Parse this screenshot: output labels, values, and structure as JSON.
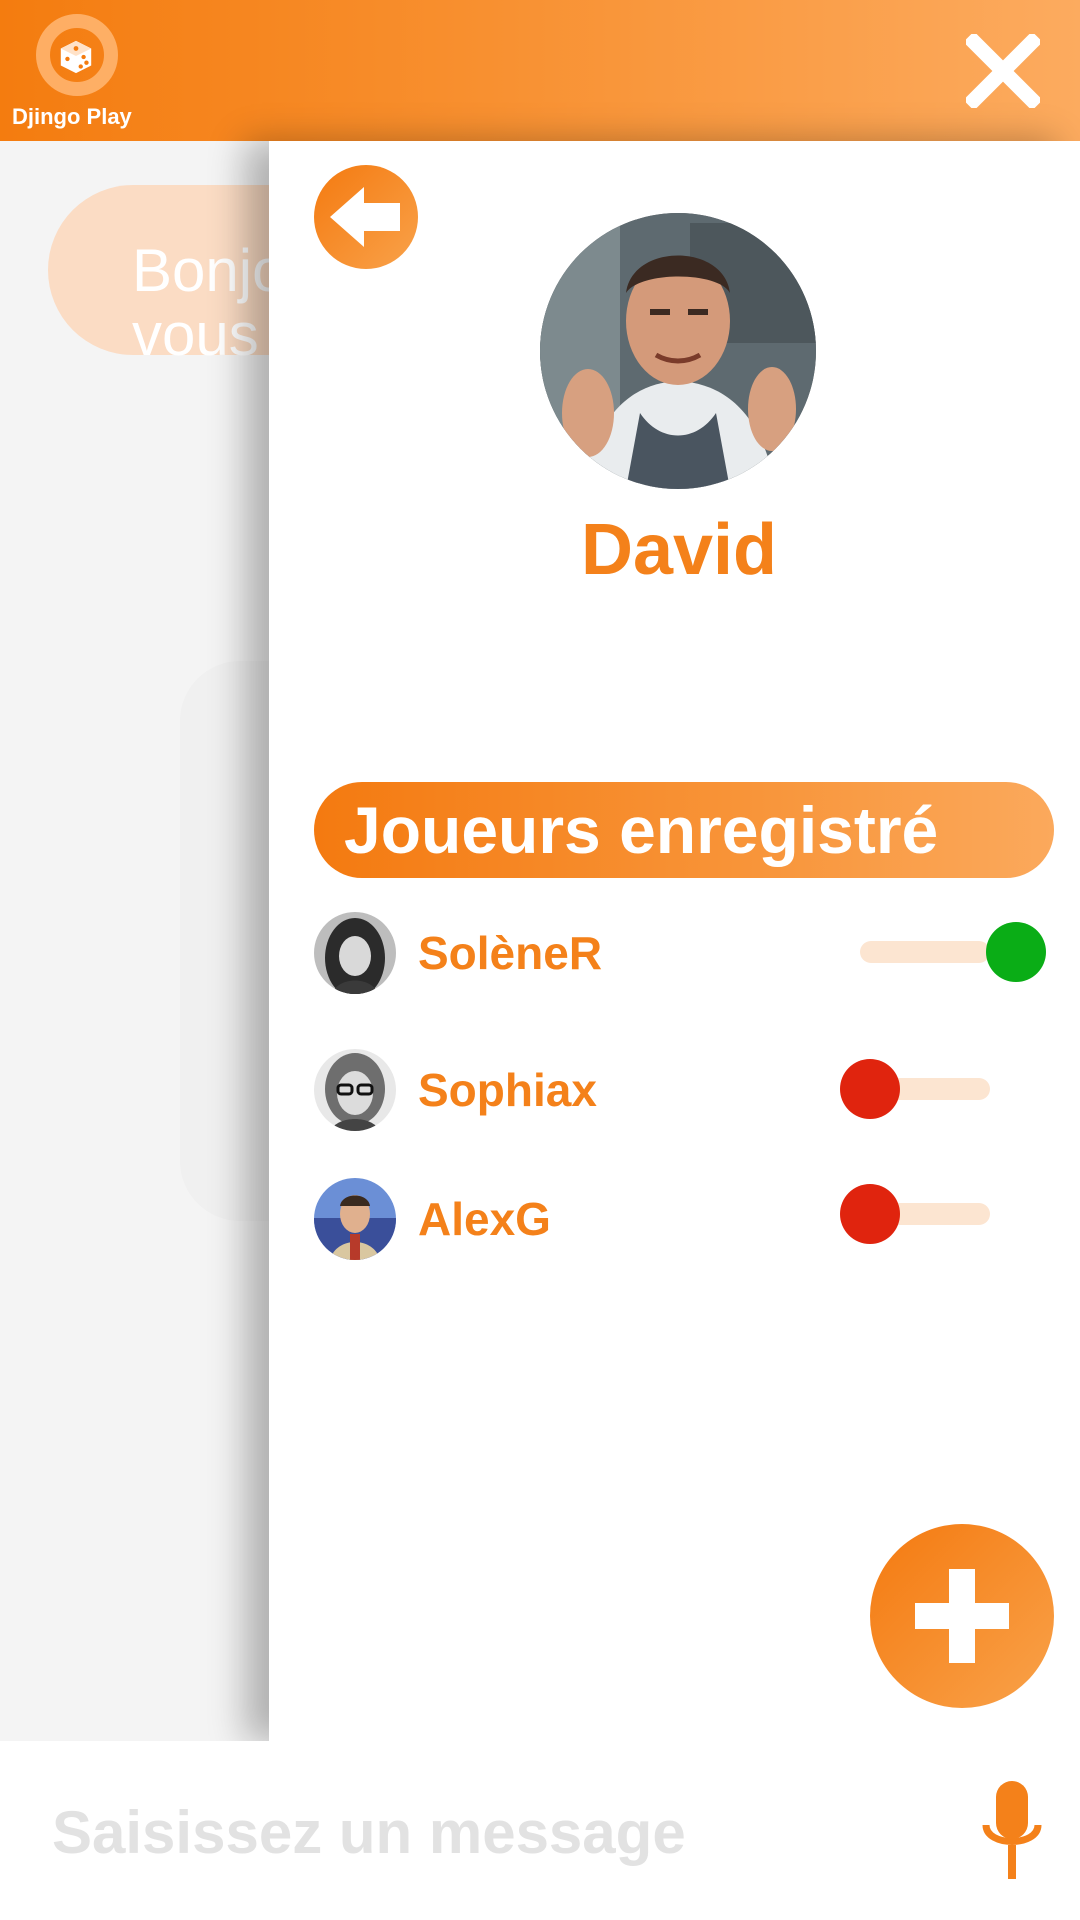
{
  "app": {
    "name": "Djingo Play",
    "accent_color": "#f4811a"
  },
  "background_chat": {
    "bubble_text": "Bonjo\nvous"
  },
  "profile": {
    "name": "David",
    "avatar": "david-avatar"
  },
  "players_section": {
    "title": "Joueurs enregistré",
    "players": [
      {
        "name": "SolèneR",
        "enabled": true,
        "toggle_color": "#0aad16"
      },
      {
        "name": "Sophiax",
        "enabled": false,
        "toggle_color": "#e0240e"
      },
      {
        "name": "AlexG",
        "enabled": false,
        "toggle_color": "#e0240e"
      }
    ]
  },
  "composer": {
    "placeholder": "Saisissez un message"
  },
  "icons": {
    "close": "close-icon",
    "back": "back-arrow-icon",
    "add": "plus-icon",
    "mic": "microphone-icon",
    "logo": "dice-icon"
  }
}
